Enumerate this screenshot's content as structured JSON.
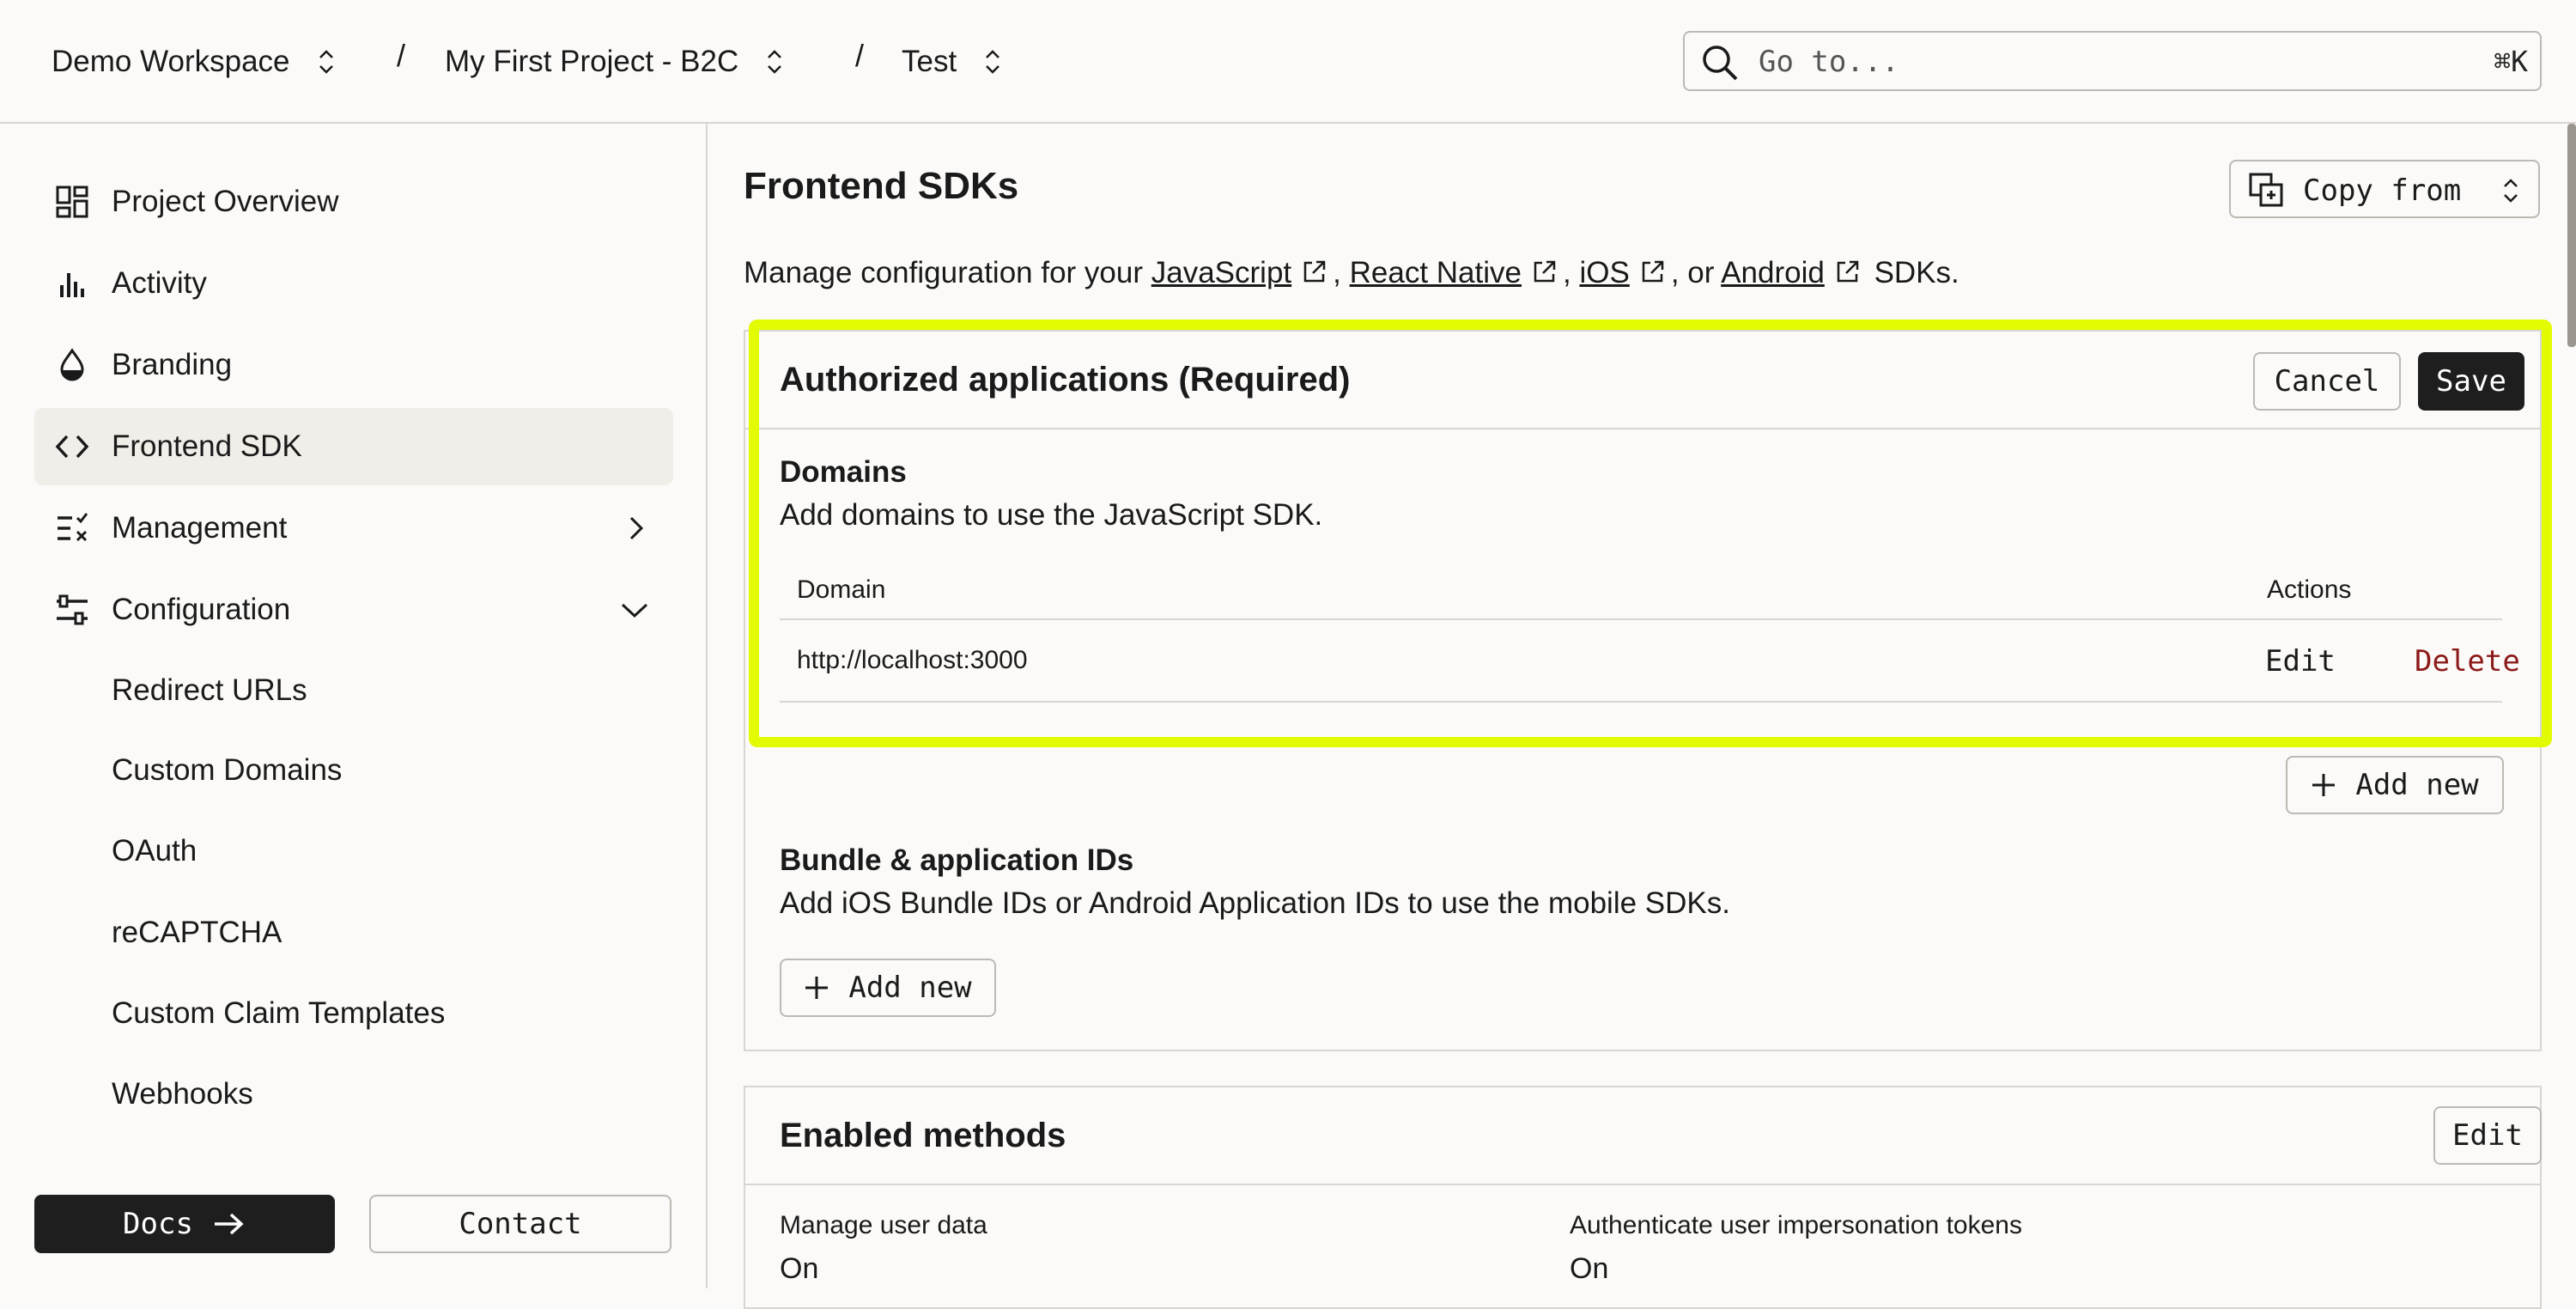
{
  "topbar": {
    "workspace": "Demo Workspace",
    "project": "My First Project - B2C",
    "environment": "Test",
    "separator": "/",
    "search_placeholder": "Go to...",
    "search_shortcut": "⌘K"
  },
  "sidebar": {
    "items": [
      {
        "label": "Project Overview",
        "icon": "dashboard-icon"
      },
      {
        "label": "Activity",
        "icon": "bar-chart-icon"
      },
      {
        "label": "Branding",
        "icon": "drop-icon"
      },
      {
        "label": "Frontend SDK",
        "icon": "code-icon",
        "active": true
      },
      {
        "label": "Management",
        "icon": "checklist-icon"
      },
      {
        "label": "Configuration",
        "icon": "sliders-icon"
      }
    ],
    "config_subitems": [
      "Redirect URLs",
      "Custom Domains",
      "OAuth",
      "reCAPTCHA",
      "Custom Claim Templates",
      "Webhooks"
    ],
    "docs_label": "Docs",
    "contact_label": "Contact"
  },
  "main": {
    "title": "Frontend SDKs",
    "copy_from_label": "Copy from",
    "desc_prefix": "Manage configuration for your",
    "links": [
      "JavaScript",
      "React Native",
      "iOS",
      "Android"
    ],
    "desc_sep1": ",",
    "desc_sep2": ",",
    "desc_sep3": ", or",
    "desc_suffix": "SDKs.",
    "authorized": {
      "title": "Authorized applications (Required)",
      "cancel_label": "Cancel",
      "save_label": "Save",
      "domains_title": "Domains",
      "domains_desc": "Add domains to use the JavaScript SDK.",
      "col_domain": "Domain",
      "col_actions": "Actions",
      "rows": [
        {
          "domain": "http://localhost:3000",
          "edit": "Edit",
          "delete": "Delete"
        }
      ],
      "add_new_label": "Add new",
      "bundle_title": "Bundle & application IDs",
      "bundle_desc": "Add iOS Bundle IDs or Android Application IDs to use the mobile SDKs.",
      "bundle_add_label": "Add new"
    },
    "enabled": {
      "title": "Enabled methods",
      "edit_label": "Edit",
      "fields": [
        {
          "label": "Manage user data",
          "value": "On"
        },
        {
          "label": "Authenticate user impersonation tokens",
          "value": "On"
        }
      ]
    }
  },
  "colors": {
    "highlight": "#e2fb00",
    "danger": "#8c1a1a",
    "dark": "#1e1e1e"
  }
}
